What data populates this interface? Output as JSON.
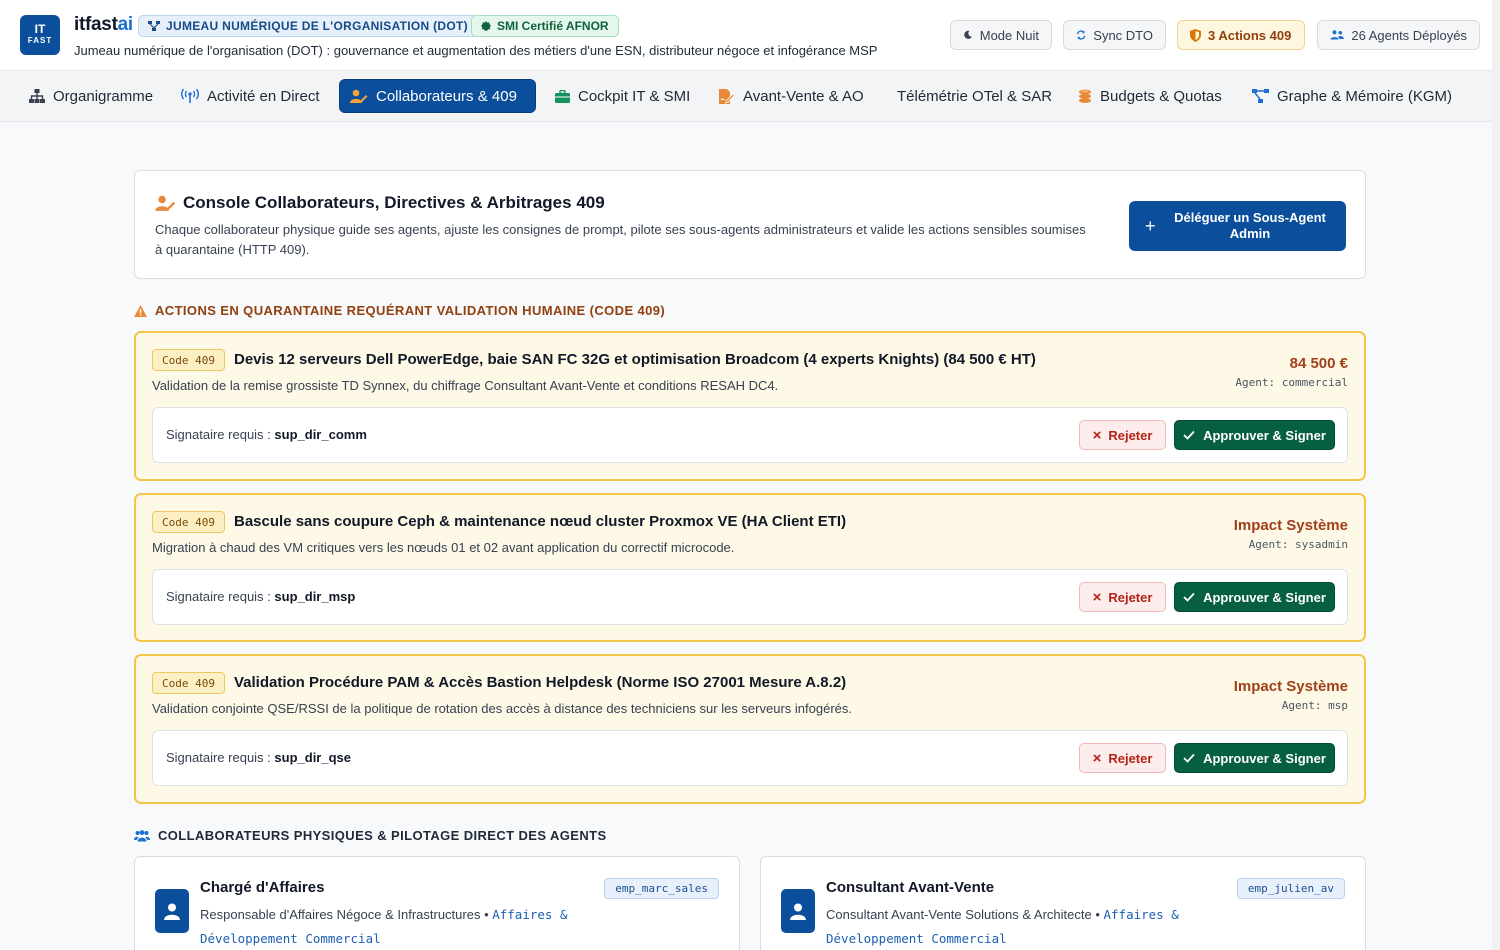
{
  "header": {
    "logo_line1": "IT",
    "logo_line2": "FAST",
    "brand_main": "itfast",
    "brand_accent": "ai",
    "badge_dot": "JUMEAU NUMÉRIQUE DE L'ORGANISATION (DOT)",
    "badge_smi": "SMI Certifié AFNOR",
    "subtitle": "Jumeau numérique de l'organisation (DOT) : gouvernance et augmentation des métiers d'une ESN, distributeur négoce et infogérance MSP",
    "buttons": {
      "night": "Mode Nuit",
      "sync": "Sync DTO",
      "actions": "3 Actions 409",
      "agents": "26 Agents Déployés"
    }
  },
  "nav": {
    "tabs": [
      {
        "label": "Organigramme",
        "icon": "sitemap-icon"
      },
      {
        "label": "Activité en Direct",
        "icon": "broadcast-icon"
      },
      {
        "label": "Collaborateurs & 409",
        "icon": "user-edit-icon",
        "active": true
      },
      {
        "label": "Cockpit IT & SMI",
        "icon": "briefcase-icon"
      },
      {
        "label": "Avant-Vente & AO",
        "icon": "file-signature-icon"
      },
      {
        "label": "Télémétrie OTel & SAR",
        "icon": ""
      },
      {
        "label": "Budgets & Quotas",
        "icon": "coins-icon"
      },
      {
        "label": "Graphe & Mémoire (KGM)",
        "icon": "project-diagram-icon"
      }
    ]
  },
  "console": {
    "title": "Console Collaborateurs, Directives & Arbitrages 409",
    "description": "Chaque collaborateur physique guide ses agents, ajuste les consignes de prompt, pilote ses sous-agents administrateurs et valide les actions sensibles soumises à quarantaine (HTTP 409).",
    "delegate_button": "Déléguer un Sous-Agent Admin"
  },
  "quarantine": {
    "section_title": "ACTIONS EN QUARANTAINE REQUÉRANT VALIDATION HUMAINE (CODE 409)",
    "signer_prefix": "Signataire requis : ",
    "reject_label": "Rejeter",
    "approve_label": "Approuver & Signer",
    "items": [
      {
        "code": "Code 409",
        "title": "Devis 12 serveurs Dell PowerEdge, baie SAN FC 32G et optimisation Broadcom (4 experts Knights) (84 500 € HT)",
        "description": "Validation de la remise grossiste TD Synnex, du chiffrage Consultant Avant-Vente et conditions RESAH DC4.",
        "amount": "84 500 €",
        "agent": "Agent: commercial",
        "signer": "sup_dir_comm"
      },
      {
        "code": "Code 409",
        "title": "Bascule sans coupure Ceph & maintenance nœud cluster Proxmox VE (HA Client ETI)",
        "description": "Migration à chaud des VM critiques vers les nœuds 01 et 02 avant application du correctif microcode.",
        "amount": "Impact Système",
        "agent": "Agent: sysadmin",
        "signer": "sup_dir_msp"
      },
      {
        "code": "Code 409",
        "title": "Validation Procédure PAM & Accès Bastion Helpdesk (Norme ISO 27001 Mesure A.8.2)",
        "description": "Validation conjointe QSE/RSSI de la politique de rotation des accès à distance des techniciens sur les serveurs infogérés.",
        "amount": "Impact Système",
        "agent": "Agent: msp",
        "signer": "sup_dir_qse"
      }
    ]
  },
  "collaborators": {
    "section_title": "COLLABORATEURS PHYSIQUES & PILOTAGE DIRECT DES AGENTS",
    "items": [
      {
        "name": "Chargé d'Affaires",
        "role": "Responsable d'Affaires Négoce & Infrastructures",
        "separator": " • ",
        "department": "Affaires & Développement Commercial",
        "tag": "emp_marc_sales"
      },
      {
        "name": "Consultant Avant-Vente",
        "role": "Consultant Avant-Vente Solutions & Architecte",
        "separator": " • ",
        "department": "Affaires & Développement Commercial",
        "tag": "emp_julien_av"
      }
    ]
  },
  "colors": {
    "brand": "#0b4f9c",
    "warning": "#f3c64b",
    "approve": "#06603f",
    "reject": "#b42318"
  }
}
